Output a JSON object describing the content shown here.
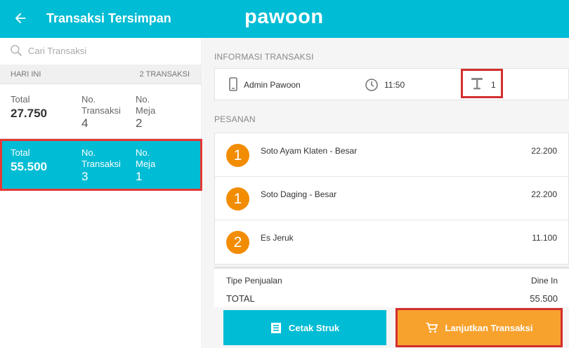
{
  "header": {
    "title": "Transaksi Tersimpan",
    "logo_text": "pawoon"
  },
  "search": {
    "placeholder": "Cari Transaksi"
  },
  "day_group": {
    "label": "HARI INI",
    "count_label": "2 TRANSAKSI"
  },
  "transactions": [
    {
      "total_label": "Total",
      "total": "27.750",
      "txn_label_1": "No.",
      "txn_label_2": "Transaksi",
      "txn_no": "4",
      "table_label_1": "No.",
      "table_label_2": "Meja",
      "table_no": "2",
      "selected": false
    },
    {
      "total_label": "Total",
      "total": "55.500",
      "txn_label_1": "No.",
      "txn_label_2": "Transaksi",
      "txn_no": "3",
      "table_label_1": "No.",
      "table_label_2": "Meja",
      "table_no": "1",
      "selected": true
    }
  ],
  "info": {
    "section_label": "INFORMASI TRANSAKSI",
    "cashier": "Admin Pawoon",
    "time": "11:50",
    "table": "1"
  },
  "orders": {
    "section_label": "PESANAN",
    "items": [
      {
        "qty": "1",
        "name": "Soto Ayam Klaten - Besar",
        "price": "22.200"
      },
      {
        "qty": "1",
        "name": "Soto Daging - Besar",
        "price": "22.200"
      },
      {
        "qty": "2",
        "name": "Es Jeruk",
        "price": "11.100"
      }
    ]
  },
  "summary": {
    "sale_type_label": "Tipe Penjualan",
    "sale_type": "Dine In",
    "total_label": "TOTAL",
    "total": "55.500"
  },
  "actions": {
    "print_label": "Cetak Struk",
    "continue_label": "Lanjutkan Transaksi"
  },
  "colors": {
    "primary": "#00bcd4",
    "accent": "#f7a22d",
    "qty_badge": "#f28c00",
    "highlight": "#d32f2f"
  }
}
